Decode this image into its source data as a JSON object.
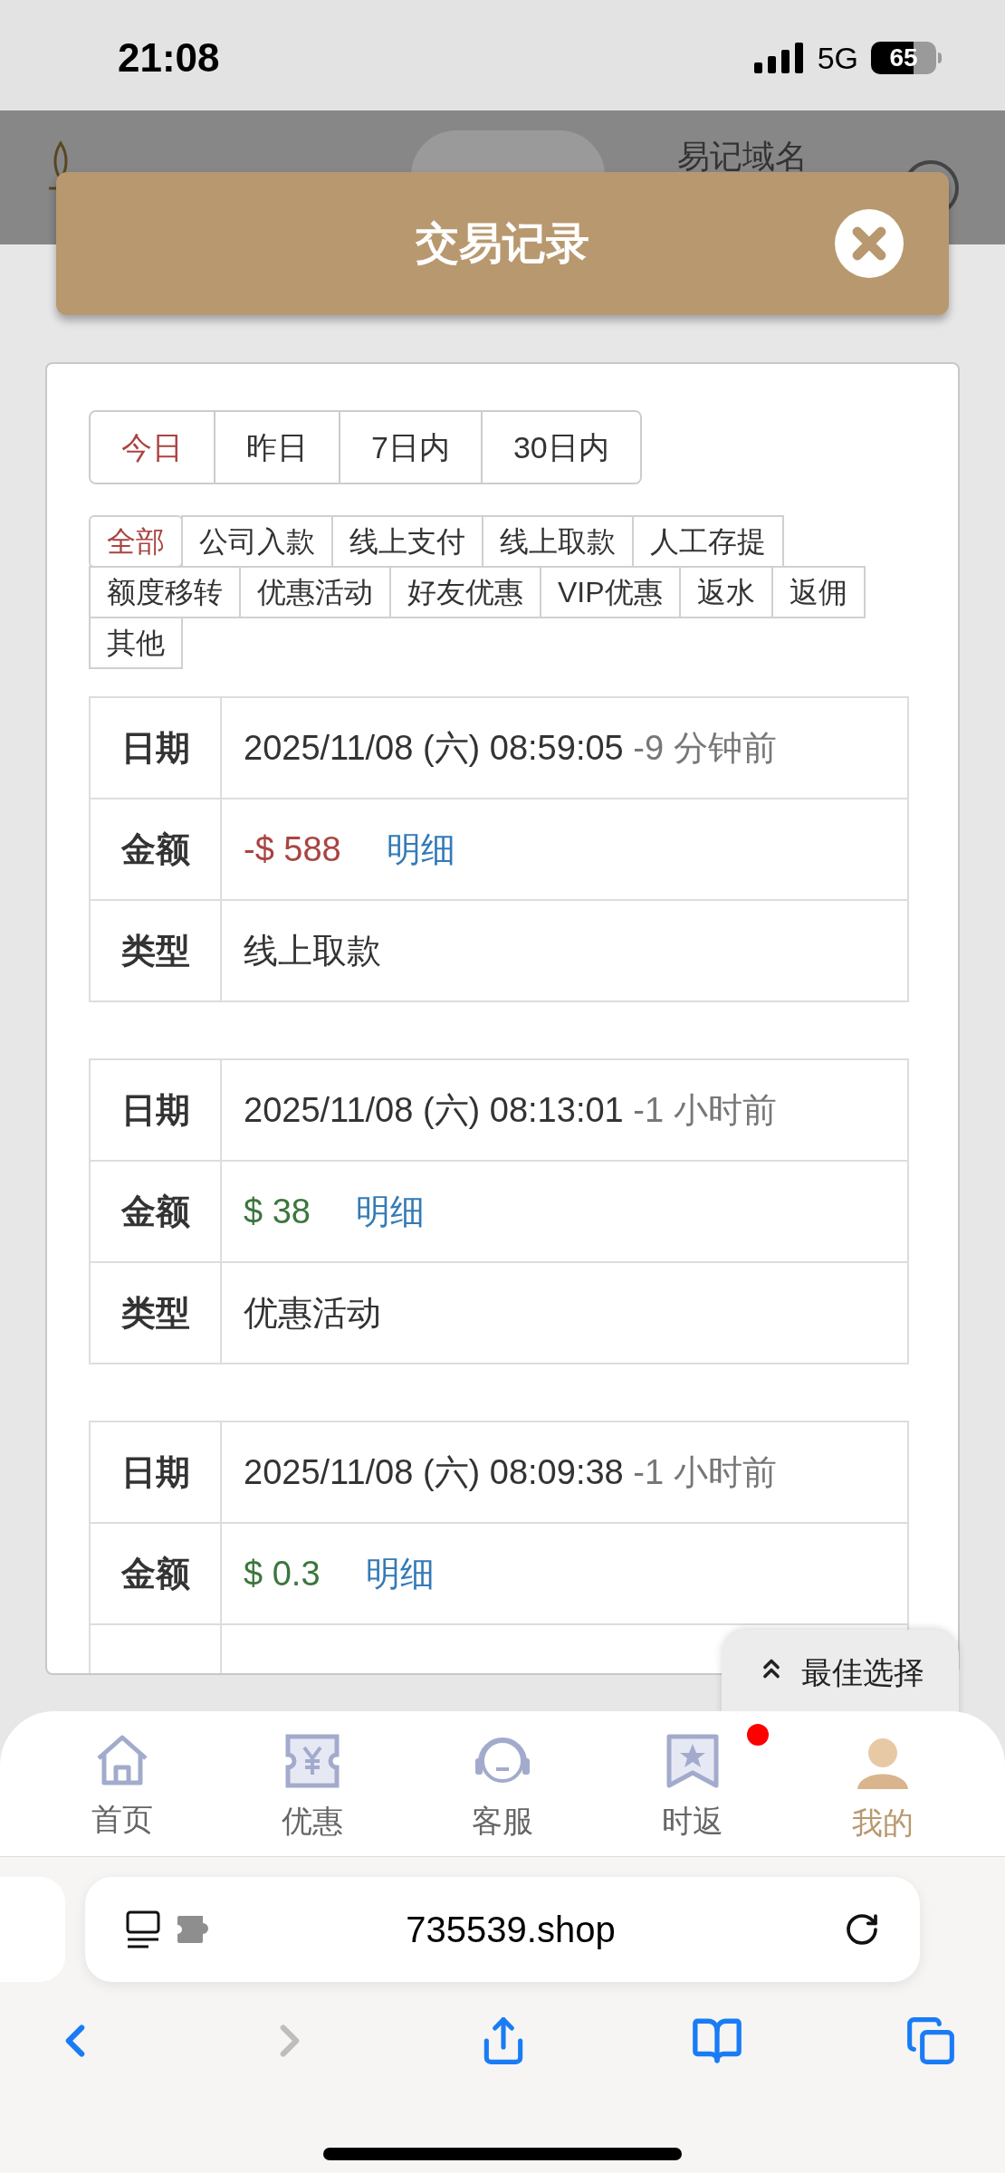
{
  "status_bar": {
    "time": "21:08",
    "network": "5G",
    "battery": "65"
  },
  "site_header": {
    "domain_link": "易记域名"
  },
  "modal": {
    "title": "交易记录",
    "date_tabs": [
      {
        "label": "今日",
        "selected": true
      },
      {
        "label": "昨日",
        "selected": false
      },
      {
        "label": "7日内",
        "selected": false
      },
      {
        "label": "30日内",
        "selected": false
      }
    ],
    "type_filter_rows": [
      [
        {
          "label": "全部",
          "selected": true
        },
        {
          "label": "公司入款",
          "selected": false
        },
        {
          "label": "线上支付",
          "selected": false
        },
        {
          "label": "线上取款",
          "selected": false
        },
        {
          "label": "人工存提",
          "selected": false
        }
      ],
      [
        {
          "label": "额度移转",
          "selected": false
        },
        {
          "label": "优惠活动",
          "selected": false
        },
        {
          "label": "好友优惠",
          "selected": false
        },
        {
          "label": "VIP优惠",
          "selected": false
        },
        {
          "label": "返水",
          "selected": false
        },
        {
          "label": "返佣",
          "selected": false
        }
      ],
      [
        {
          "label": "其他",
          "selected": false
        }
      ]
    ],
    "records": [
      {
        "date_label": "日期",
        "date": "2025/11/08 (六) 08:59:05",
        "ago": "-9 分钟前",
        "amount_label": "金额",
        "amount": "-$ 588",
        "color": "#a94442",
        "detail_link": "明细",
        "type_label": "类型",
        "type": "线上取款"
      },
      {
        "date_label": "日期",
        "date": "2025/11/08 (六) 08:13:01",
        "ago": "-1 小时前",
        "amount_label": "金额",
        "amount": "$ 38",
        "color": "#3c763d",
        "detail_link": "明细",
        "type_label": "类型",
        "type": "优惠活动"
      },
      {
        "date_label": "日期",
        "date": "2025/11/08 (六) 08:09:38",
        "ago": "-1 小时前",
        "amount_label": "金额",
        "amount": "$ 0.3",
        "color": "#3c763d",
        "detail_link": "明细"
      }
    ],
    "float_button": "最佳选择"
  },
  "bottom_nav": [
    {
      "label": "首页",
      "kind": "home",
      "selected": false,
      "badge": false
    },
    {
      "label": "优惠",
      "kind": "coupon",
      "selected": false,
      "badge": false
    },
    {
      "label": "客服",
      "kind": "support",
      "selected": false,
      "badge": false
    },
    {
      "label": "时返",
      "kind": "rebate",
      "selected": false,
      "badge": true
    },
    {
      "label": "我的",
      "kind": "profile",
      "selected": true,
      "badge": false
    }
  ],
  "browser": {
    "url": "735539.shop"
  }
}
